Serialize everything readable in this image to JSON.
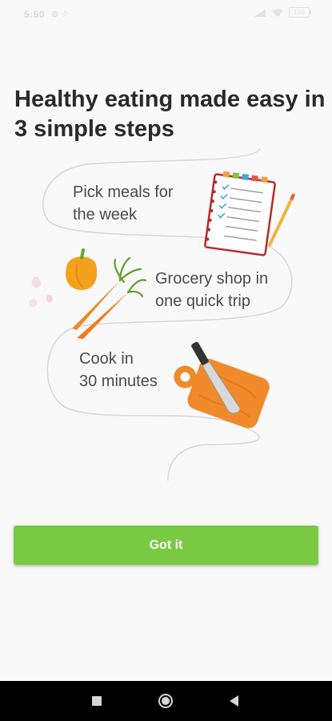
{
  "status_bar": {
    "time": "5:50",
    "left_icons": "⊙ ☆",
    "battery": "100"
  },
  "onboarding": {
    "title": "Healthy eating made easy in 3 simple steps",
    "steps": [
      {
        "text": "Pick meals for\nthe week",
        "illustration": "checklist-notebook-icon"
      },
      {
        "text": "Grocery shop in\none quick trip",
        "illustration": "vegetables-icon"
      },
      {
        "text": "Cook in\n30 minutes",
        "illustration": "cutting-board-knife-icon"
      }
    ],
    "button_label": "Got it"
  },
  "nav_bar": {
    "buttons": [
      "recent-apps",
      "home",
      "back"
    ]
  },
  "colors": {
    "accent": "#7ac943",
    "background": "#f9f9f9",
    "title": "#2a2a2a"
  }
}
